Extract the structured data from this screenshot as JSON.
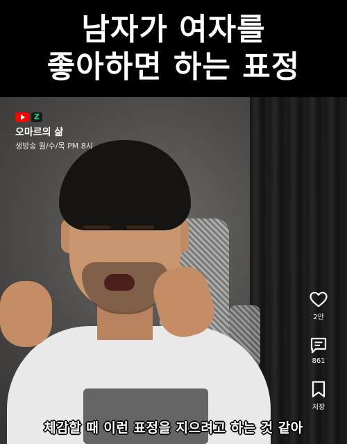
{
  "title": {
    "line1": "남자가 여자를",
    "line2": "좋아하면 하는 표정"
  },
  "channel": {
    "name": "오마르의 삶",
    "schedule": "생방송 월/수/목 PM 8시",
    "badges": [
      "youtube-icon",
      "z-logo-icon"
    ],
    "badge_z_text": "Z"
  },
  "actions": {
    "like_count": "2만",
    "comment_count": "861",
    "save_label": "저장"
  },
  "caption": "체감할 때 이런 표정을 지으려고 하는 것 같아",
  "colors": {
    "background": "#000000",
    "title_text": "#ffffff",
    "youtube_red": "#ff0000",
    "z_green": "#27e07a"
  }
}
